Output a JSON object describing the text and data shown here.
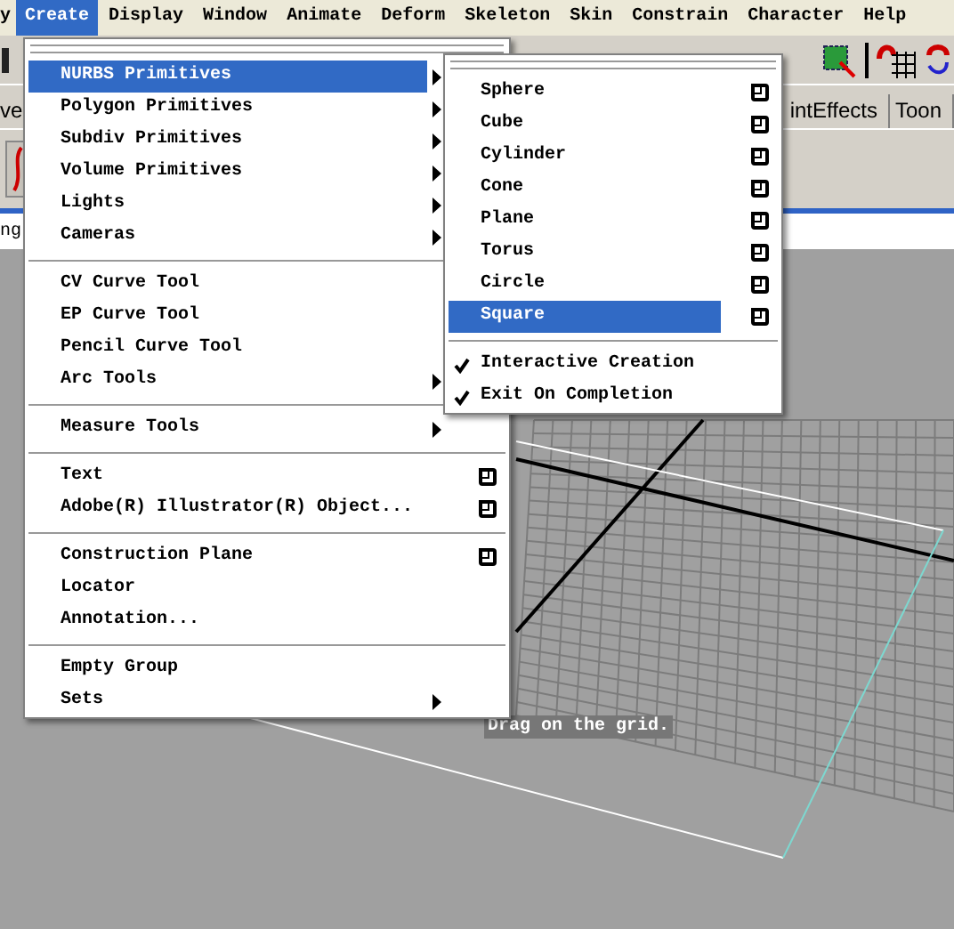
{
  "menubar": {
    "items": [
      {
        "label": "y",
        "selected": false
      },
      {
        "label": "Create",
        "selected": true
      },
      {
        "label": "Display",
        "selected": false
      },
      {
        "label": "Window",
        "selected": false
      },
      {
        "label": "Animate",
        "selected": false
      },
      {
        "label": "Deform",
        "selected": false
      },
      {
        "label": "Skeleton",
        "selected": false
      },
      {
        "label": "Skin",
        "selected": false
      },
      {
        "label": "Constrain",
        "selected": false
      },
      {
        "label": "Character",
        "selected": false
      },
      {
        "label": "Help",
        "selected": false
      }
    ]
  },
  "shelf_tabs": [
    {
      "label": "ve",
      "selected": false
    },
    {
      "label": "intEffects",
      "selected": false
    },
    {
      "label": "Toon",
      "selected": false
    }
  ],
  "status_line": {
    "text": "ng"
  },
  "create_menu": {
    "items": [
      {
        "kind": "item",
        "label": "NURBS Primitives",
        "has_submenu": true,
        "has_options": false,
        "selected": true
      },
      {
        "kind": "item",
        "label": "Polygon Primitives",
        "has_submenu": true,
        "has_options": false,
        "selected": false
      },
      {
        "kind": "item",
        "label": "Subdiv Primitives",
        "has_submenu": true,
        "has_options": false,
        "selected": false
      },
      {
        "kind": "item",
        "label": "Volume Primitives",
        "has_submenu": true,
        "has_options": false,
        "selected": false
      },
      {
        "kind": "item",
        "label": "Lights",
        "has_submenu": true,
        "has_options": false,
        "selected": false
      },
      {
        "kind": "item",
        "label": "Cameras",
        "has_submenu": true,
        "has_options": false,
        "selected": false
      },
      {
        "kind": "separator"
      },
      {
        "kind": "item",
        "label": "CV Curve Tool",
        "has_submenu": false,
        "has_options": false,
        "selected": false
      },
      {
        "kind": "item",
        "label": "EP Curve Tool",
        "has_submenu": false,
        "has_options": false,
        "selected": false
      },
      {
        "kind": "item",
        "label": "Pencil Curve Tool",
        "has_submenu": false,
        "has_options": false,
        "selected": false
      },
      {
        "kind": "item",
        "label": "Arc Tools",
        "has_submenu": true,
        "has_options": false,
        "selected": false
      },
      {
        "kind": "separator"
      },
      {
        "kind": "item",
        "label": "Measure Tools",
        "has_submenu": true,
        "has_options": false,
        "selected": false
      },
      {
        "kind": "separator"
      },
      {
        "kind": "item",
        "label": "Text",
        "has_submenu": false,
        "has_options": true,
        "selected": false
      },
      {
        "kind": "item",
        "label": "Adobe(R) Illustrator(R) Object...",
        "has_submenu": false,
        "has_options": true,
        "selected": false
      },
      {
        "kind": "separator"
      },
      {
        "kind": "item",
        "label": "Construction Plane",
        "has_submenu": false,
        "has_options": true,
        "selected": false
      },
      {
        "kind": "item",
        "label": "Locator",
        "has_submenu": false,
        "has_options": false,
        "selected": false
      },
      {
        "kind": "item",
        "label": "Annotation...",
        "has_submenu": false,
        "has_options": false,
        "selected": false
      },
      {
        "kind": "separator"
      },
      {
        "kind": "item",
        "label": "Empty Group",
        "has_submenu": false,
        "has_options": false,
        "selected": false
      },
      {
        "kind": "item",
        "label": "Sets",
        "has_submenu": true,
        "has_options": false,
        "selected": false
      }
    ]
  },
  "nurbs_submenu": {
    "items": [
      {
        "kind": "item",
        "label": "Sphere",
        "has_submenu": false,
        "has_options": true,
        "selected": false
      },
      {
        "kind": "item",
        "label": "Cube",
        "has_submenu": false,
        "has_options": true,
        "selected": false
      },
      {
        "kind": "item",
        "label": "Cylinder",
        "has_submenu": false,
        "has_options": true,
        "selected": false
      },
      {
        "kind": "item",
        "label": "Cone",
        "has_submenu": false,
        "has_options": true,
        "selected": false
      },
      {
        "kind": "item",
        "label": "Plane",
        "has_submenu": false,
        "has_options": true,
        "selected": false
      },
      {
        "kind": "item",
        "label": "Torus",
        "has_submenu": false,
        "has_options": true,
        "selected": false
      },
      {
        "kind": "item",
        "label": "Circle",
        "has_submenu": false,
        "has_options": true,
        "selected": false
      },
      {
        "kind": "item",
        "label": "Square",
        "has_submenu": false,
        "has_options": true,
        "selected": true
      },
      {
        "kind": "separator"
      },
      {
        "kind": "check",
        "label": "Interactive Creation",
        "checked": true
      },
      {
        "kind": "check",
        "label": "Exit On Completion",
        "checked": true
      }
    ]
  },
  "viewport": {
    "hint": "Drag on the grid."
  }
}
